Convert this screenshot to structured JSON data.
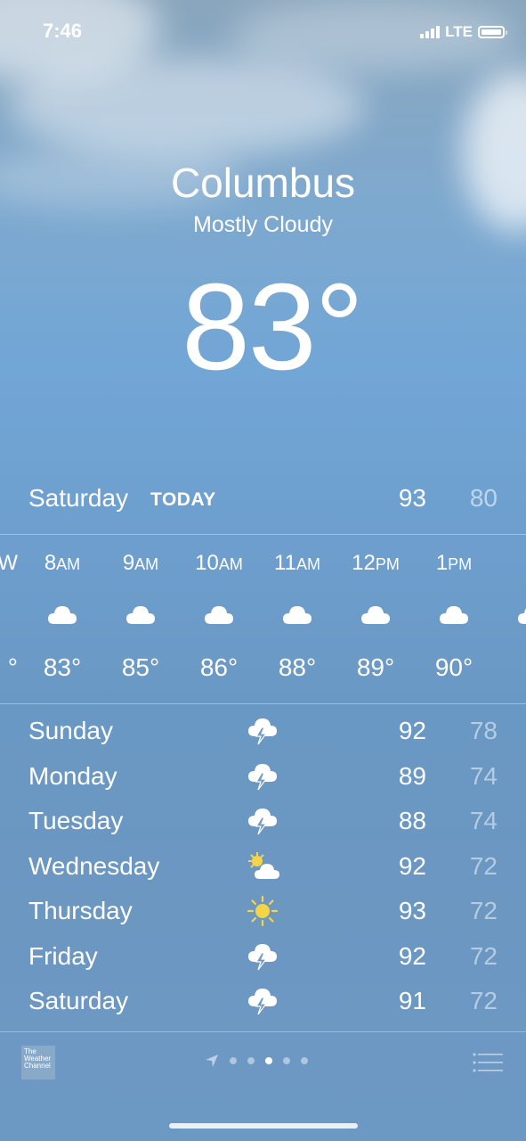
{
  "status_bar": {
    "time": "7:46",
    "network": "LTE"
  },
  "location": {
    "city": "Columbus",
    "condition": "Mostly Cloudy",
    "temperature": "83°"
  },
  "today": {
    "day": "Saturday",
    "label": "TODAY",
    "high": "93",
    "low": "80"
  },
  "hourly": [
    {
      "hour": "8",
      "period": "AM",
      "icon": "cloud-icon",
      "temp": "83°"
    },
    {
      "hour": "9",
      "period": "AM",
      "icon": "cloud-icon",
      "temp": "85°"
    },
    {
      "hour": "10",
      "period": "AM",
      "icon": "cloud-icon",
      "temp": "86°"
    },
    {
      "hour": "11",
      "period": "AM",
      "icon": "cloud-icon",
      "temp": "88°"
    },
    {
      "hour": "12",
      "period": "PM",
      "icon": "cloud-icon",
      "temp": "89°"
    },
    {
      "hour": "1",
      "period": "PM",
      "icon": "cloud-icon",
      "temp": "90°"
    }
  ],
  "daily": [
    {
      "day": "Sunday",
      "icon": "thunderstorm-icon",
      "high": "92",
      "low": "78"
    },
    {
      "day": "Monday",
      "icon": "thunderstorm-icon",
      "high": "89",
      "low": "74"
    },
    {
      "day": "Tuesday",
      "icon": "thunderstorm-icon",
      "high": "88",
      "low": "74"
    },
    {
      "day": "Wednesday",
      "icon": "partly-sunny-icon",
      "high": "92",
      "low": "72"
    },
    {
      "day": "Thursday",
      "icon": "sun-icon",
      "high": "93",
      "low": "72"
    },
    {
      "day": "Friday",
      "icon": "thunderstorm-icon",
      "high": "92",
      "low": "72"
    },
    {
      "day": "Saturday",
      "icon": "thunderstorm-icon",
      "high": "91",
      "low": "72"
    }
  ],
  "footer": {
    "provider_logo_text": "The Weather Channel",
    "page_count": 6,
    "active_page": 4
  },
  "colors": {
    "sun": "#f5d547",
    "text": "#ffffff"
  }
}
